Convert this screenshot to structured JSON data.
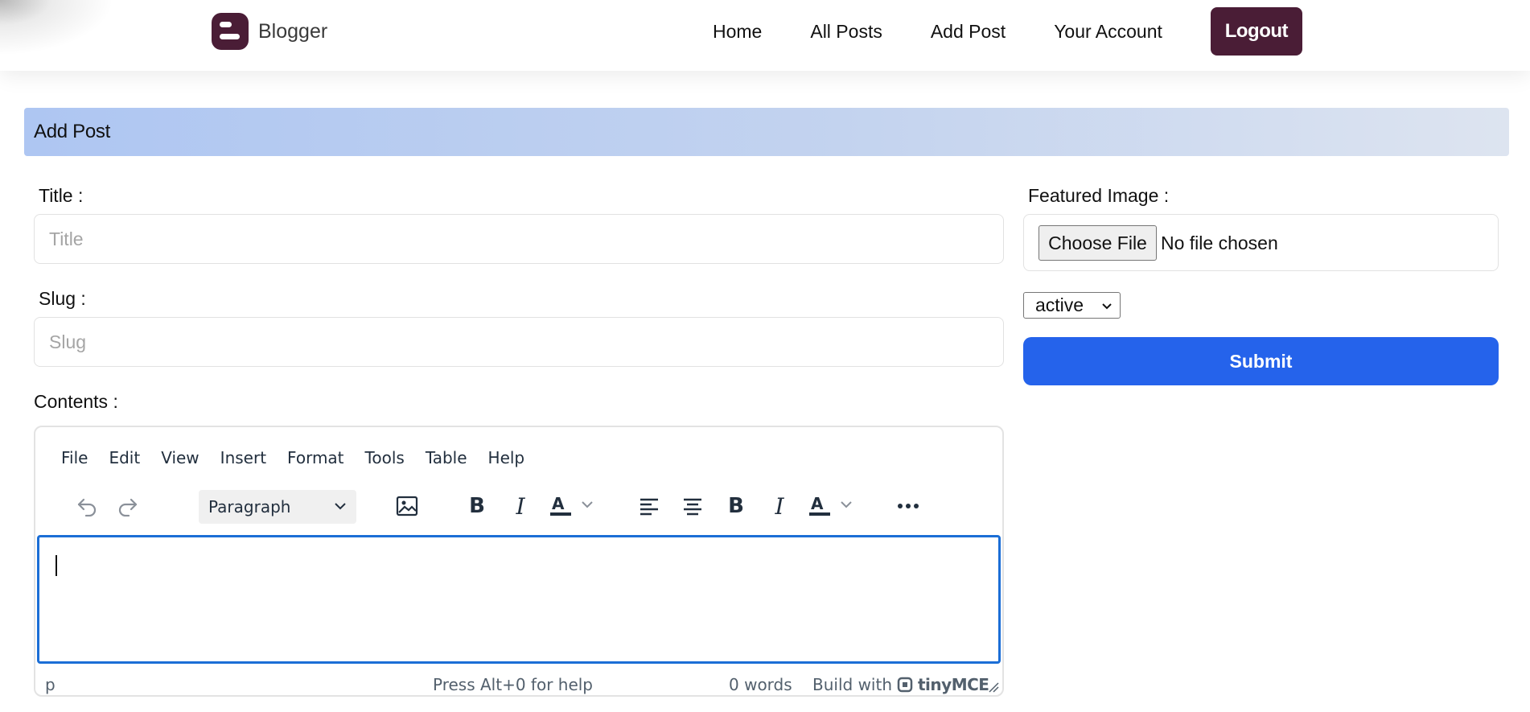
{
  "header": {
    "brand": "Blogger",
    "nav": [
      {
        "label": "Home"
      },
      {
        "label": "All Posts"
      },
      {
        "label": "Add Post"
      },
      {
        "label": "Your Account"
      }
    ],
    "logout_label": "Logout",
    "brand_color": "#4a1d36"
  },
  "section": {
    "title": "Add Post"
  },
  "form": {
    "title_label": "Title :",
    "title_placeholder": "Title",
    "title_value": "",
    "slug_label": "Slug :",
    "slug_placeholder": "Slug",
    "slug_value": "",
    "contents_label": "Contents :",
    "featured_label": "Featured Image :",
    "choose_file_label": "Choose File",
    "file_status": "No file chosen",
    "status_value": "active",
    "submit_label": "Submit",
    "submit_color": "#2563eb"
  },
  "editor": {
    "menu": [
      "File",
      "Edit",
      "View",
      "Insert",
      "Format",
      "Tools",
      "Table",
      "Help"
    ],
    "block_format": "Paragraph",
    "toolbar_icons": [
      "undo-icon",
      "redo-icon",
      "image-icon",
      "bold-icon",
      "italic-icon",
      "text-color-icon",
      "align-left-icon",
      "align-center-icon",
      "bold-icon",
      "italic-icon",
      "text-color-icon",
      "more-icon"
    ],
    "status_path": "p",
    "help_text": "Press Alt+0 for help",
    "word_count": "0 words",
    "build_text": "Build with",
    "brand": "tinyMCE",
    "focus_color": "#1b6ed6"
  }
}
